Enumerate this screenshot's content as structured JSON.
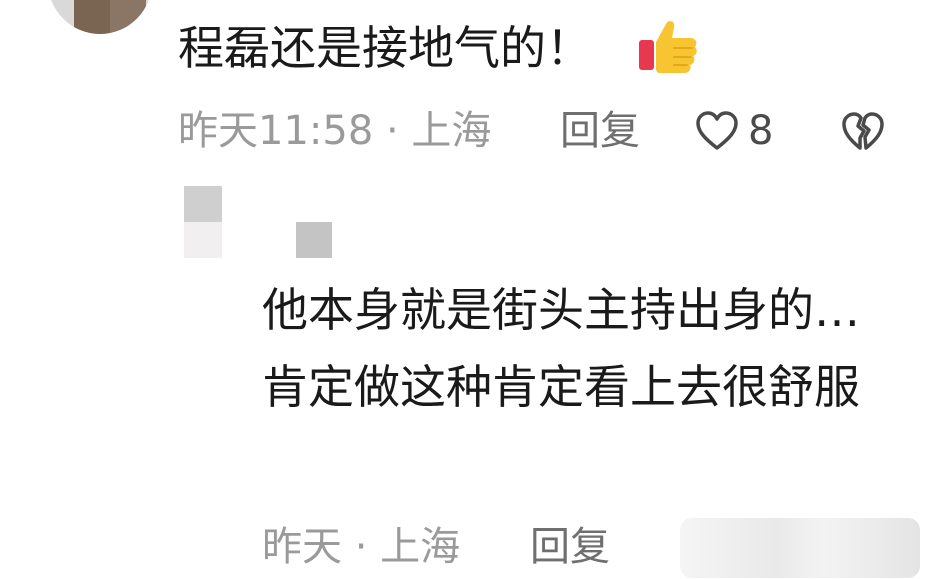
{
  "comment": {
    "text": "程磊还是接地气的！",
    "meta": "昨天11:58 · 上海",
    "reply_label": "回复",
    "like_count": "8",
    "icons": {
      "emoji": "thumbs-up-emoji",
      "like": "heart-outline-icon",
      "dislike": "broken-heart-icon"
    }
  },
  "reply": {
    "text": "他本身就是街头主持出身的…肯定做这种肯定看上去很舒服",
    "meta": "昨天 · 上海",
    "reply_label": "回复"
  },
  "colors": {
    "text": "#1a1a1a",
    "meta": "#9a9a9a",
    "reply_button": "#6f6f6f",
    "thumb_yellow": "#f7c531",
    "thumb_red": "#e8384f"
  }
}
